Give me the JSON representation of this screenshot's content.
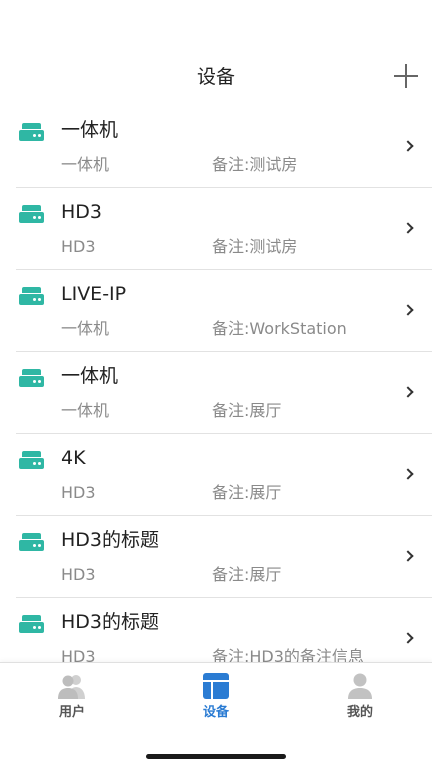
{
  "header": {
    "title": "设备",
    "add_icon": "plus-icon"
  },
  "devices": [
    {
      "name": "一体机",
      "type": "一体机",
      "remark": "备注:测试房"
    },
    {
      "name": "HD3",
      "type": "HD3",
      "remark": "备注:测试房"
    },
    {
      "name": "LIVE-IP",
      "type": "一体机",
      "remark": "备注:WorkStation"
    },
    {
      "name": "一体机",
      "type": "一体机",
      "remark": "备注:展厅"
    },
    {
      "name": "4K",
      "type": "HD3",
      "remark": "备注:展厅"
    },
    {
      "name": "HD3的标题",
      "type": "HD3",
      "remark": "备注:展厅"
    },
    {
      "name": "HD3的标题",
      "type": "HD3",
      "remark": "备注:HD3的备注信息"
    }
  ],
  "tabbar": {
    "tabs": [
      {
        "label": "用户",
        "icon": "users-icon",
        "active": false
      },
      {
        "label": "设备",
        "icon": "device-tab-icon",
        "active": true
      },
      {
        "label": "我的",
        "icon": "profile-icon",
        "active": false
      }
    ]
  },
  "colors": {
    "device_icon": "#2fb7a4",
    "active_tab": "#2b7cd3",
    "inactive_icon": "#c2c2c2"
  }
}
